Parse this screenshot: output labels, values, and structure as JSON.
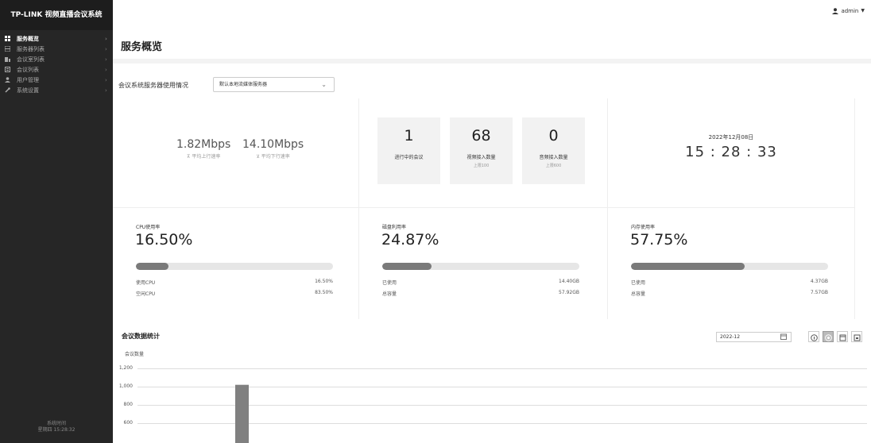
{
  "app": {
    "brand": "TP-LINK 视频直播会议系统"
  },
  "sidebar": {
    "items": [
      {
        "label": "服务概览",
        "icon": "grid-icon",
        "active": true
      },
      {
        "label": "服务器列表",
        "icon": "server-icon",
        "active": false
      },
      {
        "label": "会议室列表",
        "icon": "room-icon",
        "active": false
      },
      {
        "label": "会议列表",
        "icon": "list-icon",
        "active": false
      },
      {
        "label": "用户管理",
        "icon": "user-icon",
        "active": false
      },
      {
        "label": "系统设置",
        "icon": "wrench-icon",
        "active": false
      }
    ],
    "system_time_label": "系统时间",
    "system_time_value": "星期四 15:28:32"
  },
  "header": {
    "user": "admin"
  },
  "page": {
    "title": "服务概览"
  },
  "usage": {
    "label": "会议系统服务器使用情况",
    "server_selected": "默认本地流媒体服务器"
  },
  "network": {
    "upload": "1.82Mbps",
    "upload_label": "平均上行速率",
    "download": "14.10Mbps",
    "download_label": "平均下行速率"
  },
  "counts": [
    {
      "value": "1",
      "label": "进行中的会议",
      "limit": ""
    },
    {
      "value": "68",
      "label": "视频接入数量",
      "limit": "上限100"
    },
    {
      "value": "0",
      "label": "音频接入数量",
      "limit": "上限600"
    }
  ],
  "clock": {
    "date": "2022年12月08日",
    "time": "15 : 28 : 33"
  },
  "resources": [
    {
      "title": "CPU使用率",
      "percent": "16.50%",
      "fraction": 0.165,
      "row1_label": "使用CPU",
      "row1_value": "16.50%",
      "row2_label": "空闲CPU",
      "row2_value": "83.50%"
    },
    {
      "title": "磁盘利用率",
      "percent": "24.87%",
      "fraction": 0.2487,
      "row1_label": "已使用",
      "row1_value": "14.40GB",
      "row2_label": "总容量",
      "row2_value": "57.92GB"
    },
    {
      "title": "内存使用率",
      "percent": "57.75%",
      "fraction": 0.5775,
      "row1_label": "已使用",
      "row1_value": "4.37GB",
      "row2_label": "总容量",
      "row2_value": "7.57GB"
    }
  ],
  "stats": {
    "title": "会议数据统计",
    "month": "2022-12"
  },
  "chart_data": {
    "type": "bar",
    "ylabel": "会议数量",
    "y_ticks": [
      "1,200",
      "1,000",
      "800",
      "600"
    ],
    "ylim": [
      600,
      1200
    ],
    "bars": [
      {
        "y": 1020
      }
    ],
    "grid": true,
    "color": "#808080"
  }
}
